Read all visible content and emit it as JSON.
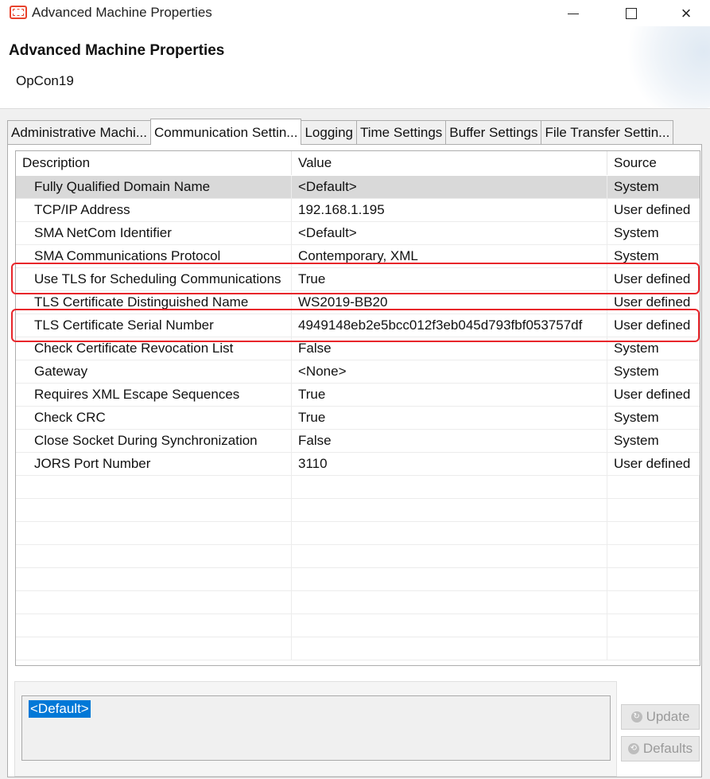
{
  "window": {
    "title": "Advanced Machine Properties",
    "controls": {
      "minimize": "minimize",
      "maximize": "maximize",
      "close": "×"
    }
  },
  "header": {
    "title": "Advanced Machine Properties",
    "machine_name": "OpCon19"
  },
  "tabs": [
    {
      "label": "Administrative Machi...",
      "active": false
    },
    {
      "label": "Communication Settin...",
      "active": true
    },
    {
      "label": "Logging",
      "active": false
    },
    {
      "label": "Time Settings",
      "active": false
    },
    {
      "label": "Buffer Settings",
      "active": false
    },
    {
      "label": "File Transfer Settin...",
      "active": false
    }
  ],
  "table": {
    "columns": {
      "description": "Description",
      "value": "Value",
      "source": "Source"
    },
    "rows": [
      {
        "description": "Fully Qualified Domain Name",
        "value": "<Default>",
        "source": "System",
        "selected": true
      },
      {
        "description": "TCP/IP Address",
        "value": "192.168.1.195",
        "source": "User defined"
      },
      {
        "description": "SMA NetCom Identifier",
        "value": "<Default>",
        "source": "System"
      },
      {
        "description": "SMA Communications Protocol",
        "value": "Contemporary, XML",
        "source": "System"
      },
      {
        "description": "Use TLS for Scheduling Communications",
        "value": "True",
        "source": "User defined",
        "highlighted": true
      },
      {
        "description": "TLS Certificate Distinguished Name",
        "value": "WS2019-BB20",
        "source": "User defined"
      },
      {
        "description": "TLS Certificate Serial Number",
        "value": "4949148eb2e5bcc012f3eb045d793fbf053757df",
        "source": "User defined",
        "highlighted": true
      },
      {
        "description": "Check Certificate Revocation List",
        "value": "False",
        "source": "System"
      },
      {
        "description": "Gateway",
        "value": "<None>",
        "source": "System"
      },
      {
        "description": "Requires XML Escape Sequences",
        "value": "True",
        "source": "User defined"
      },
      {
        "description": "Check CRC",
        "value": "True",
        "source": "System"
      },
      {
        "description": "Close Socket During Synchronization",
        "value": "False",
        "source": "System"
      },
      {
        "description": "JORS Port Number",
        "value": "3110",
        "source": "User defined"
      }
    ],
    "empty_rows": 8
  },
  "editor": {
    "value": "<Default>"
  },
  "buttons": {
    "update": "Update",
    "defaults": "Defaults"
  },
  "colors": {
    "highlight_border": "#e8262b",
    "selection_blue": "#0078d7",
    "selected_row": "#d9d9d9"
  }
}
